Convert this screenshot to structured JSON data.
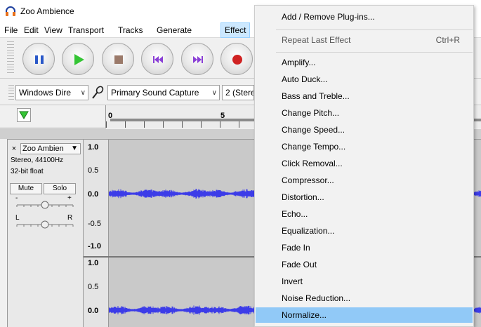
{
  "window": {
    "title": "Zoo Ambience"
  },
  "menubar": {
    "items": [
      "File",
      "Edit",
      "View",
      "Transport",
      "Tracks",
      "Generate",
      "Effect"
    ],
    "active": "Effect"
  },
  "devices": {
    "host": "Windows Dire",
    "recording_device": "Primary Sound Capture",
    "channels": "2 (Stere"
  },
  "timeline": {
    "labels": [
      "0",
      "5"
    ]
  },
  "track": {
    "name": "Zoo Ambien",
    "info_rate": "Stereo, 44100Hz",
    "info_format": "32-bit float",
    "mute_label": "Mute",
    "solo_label": "Solo",
    "gain_minus": "-",
    "gain_plus": "+",
    "pan_left": "L",
    "pan_right": "R",
    "close_glyph": "×",
    "name_arrow": "▼"
  },
  "scale": {
    "ch1": [
      "1.0",
      "0.5",
      "0.0",
      "-0.5",
      "-1.0"
    ],
    "ch2": [
      "1.0",
      "0.5",
      "0.0"
    ]
  },
  "effect_menu": {
    "items": [
      {
        "label": "Add / Remove Plug-ins...",
        "state": "normal"
      },
      {
        "label": "Repeat Last Effect",
        "shortcut": "Ctrl+R",
        "state": "disabled"
      },
      {
        "label": "Amplify...",
        "state": "normal"
      },
      {
        "label": "Auto Duck...",
        "state": "normal"
      },
      {
        "label": "Bass and Treble...",
        "state": "normal"
      },
      {
        "label": "Change Pitch...",
        "state": "normal"
      },
      {
        "label": "Change Speed...",
        "state": "normal"
      },
      {
        "label": "Change Tempo...",
        "state": "normal"
      },
      {
        "label": "Click Removal...",
        "state": "normal"
      },
      {
        "label": "Compressor...",
        "state": "normal"
      },
      {
        "label": "Distortion...",
        "state": "normal"
      },
      {
        "label": "Echo...",
        "state": "normal"
      },
      {
        "label": "Equalization...",
        "state": "normal"
      },
      {
        "label": "Fade In",
        "state": "normal"
      },
      {
        "label": "Fade Out",
        "state": "normal"
      },
      {
        "label": "Invert",
        "state": "normal"
      },
      {
        "label": "Noise Reduction...",
        "state": "normal"
      },
      {
        "label": "Normalize...",
        "state": "highlighted"
      }
    ]
  },
  "colors": {
    "waveform": "#3c3ce8",
    "menu_highlight": "#91c9f7",
    "menubar_active": "#cce8ff",
    "play_green": "#35c535",
    "record_red": "#d02222",
    "pause_blue": "#2a58c8",
    "stop_brown": "#9b7a6a",
    "skip_purple": "#8a3fd6"
  },
  "icons": {
    "app": "headphones-icon",
    "pause": "pause-icon",
    "play": "play-icon",
    "stop": "stop-icon",
    "skip_start": "skip-to-start-icon",
    "skip_end": "skip-to-end-icon",
    "record": "record-icon",
    "mic": "microphone-icon"
  }
}
